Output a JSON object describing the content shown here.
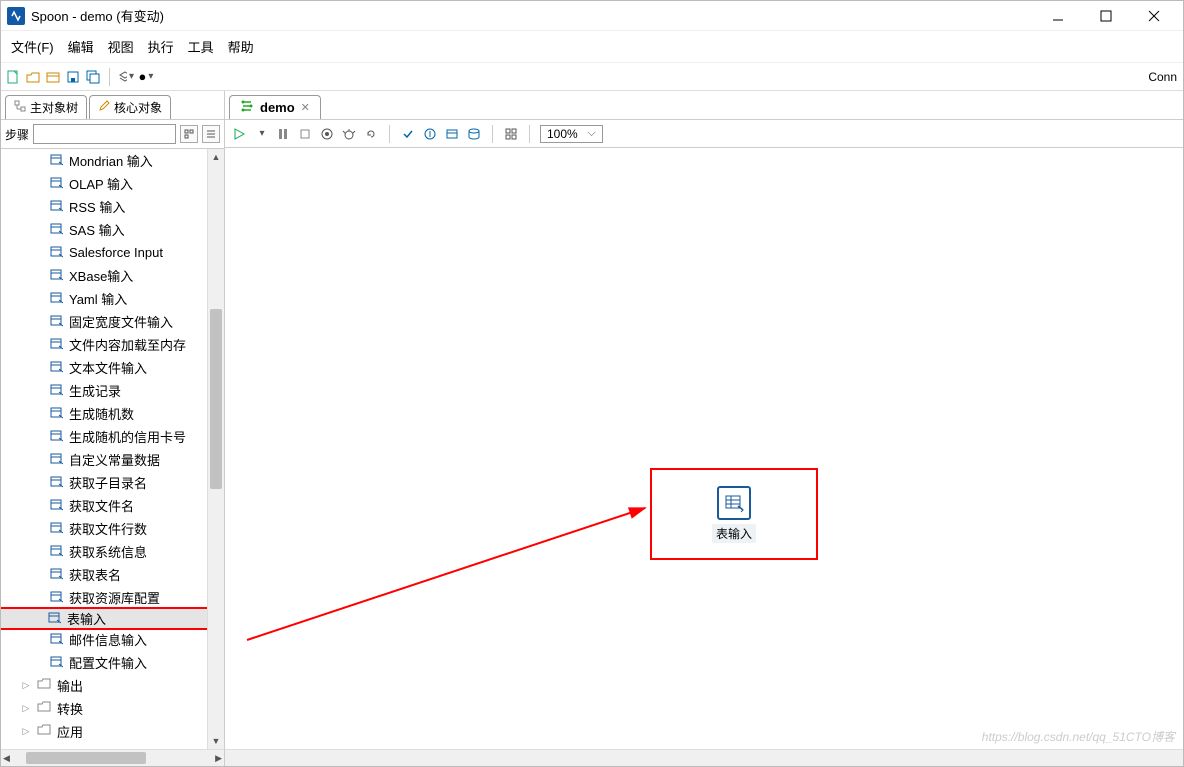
{
  "window": {
    "title": "Spoon - demo (有变动)"
  },
  "menu": {
    "file": "文件(F)",
    "edit": "编辑",
    "view": "视图",
    "run": "执行",
    "tools": "工具",
    "help": "帮助"
  },
  "toolbar_right": "Conn",
  "sidebar": {
    "tab_main": "主对象树",
    "tab_core": "核心对象",
    "search_label": "步骤"
  },
  "tree_items": [
    "Mondrian 输入",
    "OLAP 输入",
    "RSS 输入",
    "SAS 输入",
    "Salesforce Input",
    "XBase输入",
    "Yaml 输入",
    "固定宽度文件输入",
    "文件内容加载至内存",
    "文本文件输入",
    "生成记录",
    "生成随机数",
    "生成随机的信用卡号",
    "自定义常量数据",
    "获取子目录名",
    "获取文件名",
    "获取文件行数",
    "获取系统信息",
    "获取表名",
    "获取资源库配置",
    "表输入",
    "邮件信息输入",
    "配置文件输入"
  ],
  "selected_item": "表输入",
  "folders": [
    "输出",
    "转换",
    "应用"
  ],
  "canvas": {
    "tab": "demo",
    "zoom": "100%",
    "step_label": "表输入"
  },
  "watermark": "https://blog.csdn.net/qq_51CTO博客"
}
